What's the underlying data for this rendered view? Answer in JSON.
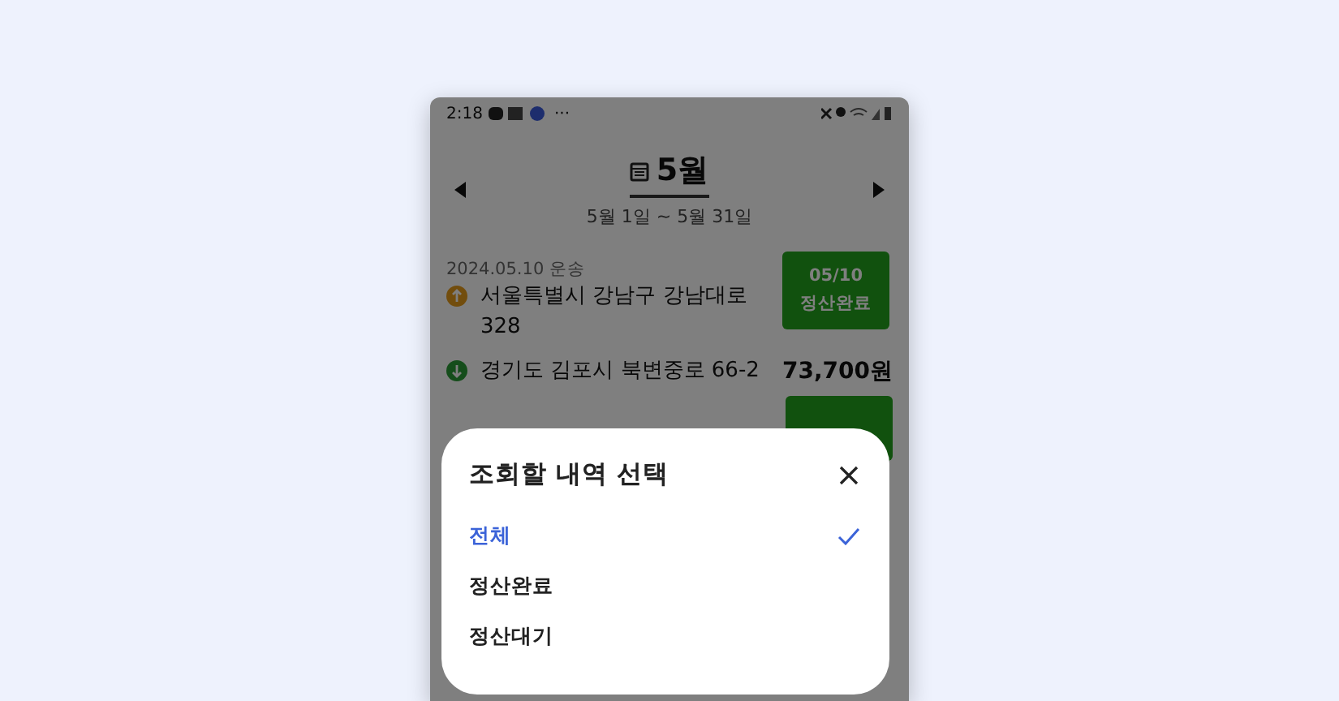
{
  "status_bar": {
    "time": "2:18",
    "more": "···"
  },
  "header": {
    "month": "5월",
    "range": "5월 1일 ~ 5월 31일"
  },
  "records": [
    {
      "date": "2024.05.10 운송",
      "badge_date": "05/10",
      "badge_status": "정산완료",
      "origin": "서울특별시 강남구 강남대로 328",
      "destination": "경기도 김포시 북변중로 66-2",
      "amount": "73,700원"
    }
  ],
  "sheet": {
    "title": "조회할 내역 선택",
    "options": [
      {
        "label": "전체",
        "selected": true
      },
      {
        "label": "정산완료",
        "selected": false
      },
      {
        "label": "정산대기",
        "selected": false
      }
    ]
  }
}
